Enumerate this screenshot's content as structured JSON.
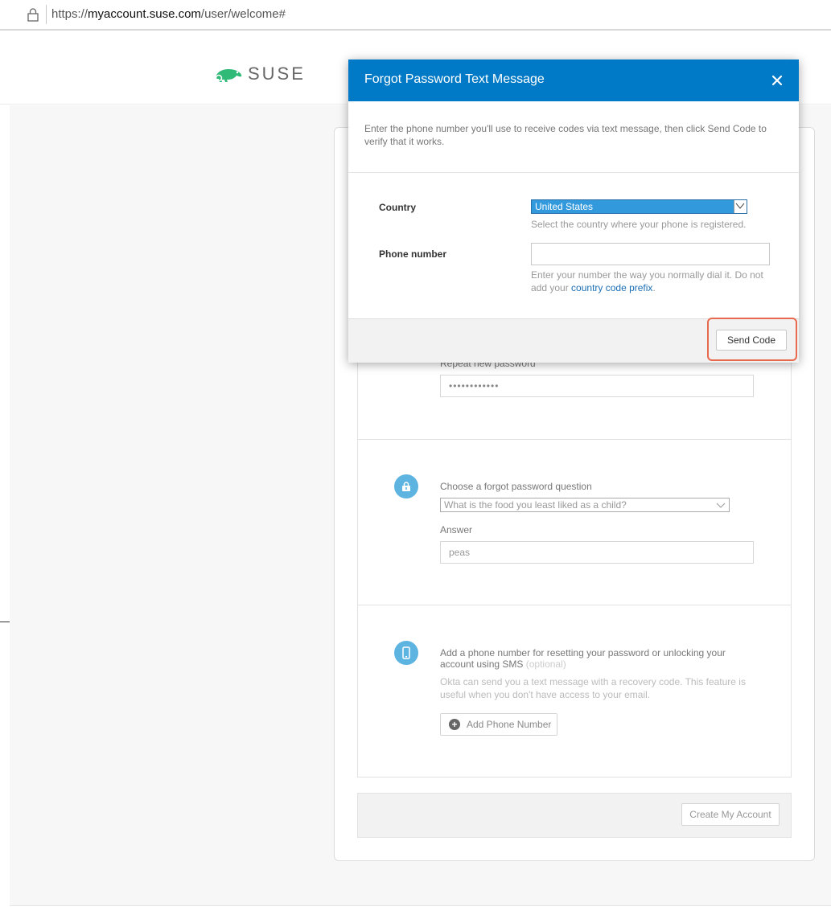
{
  "browser": {
    "url_prefix": "https://",
    "url_domain": "myaccount.suse.com",
    "url_path": "/user/welcome#"
  },
  "header": {
    "logo_text": "SUSE",
    "logo_icon": "chameleon-icon",
    "brand_color": "#30ba78"
  },
  "form": {
    "repeat_password_label": "Repeat new password",
    "repeat_password_value": "••••••••••••",
    "security_question": {
      "icon": "lock-icon",
      "label": "Choose a forgot password question",
      "selected": "What is the food you least liked as a child?",
      "answer_label": "Answer",
      "answer_value": "peas"
    },
    "sms": {
      "icon": "phone-icon",
      "title": "Add a phone number for resetting your password or unlocking your account using SMS",
      "optional": "(optional)",
      "description": "Okta can send you a text message with a recovery code. This feature is useful when you don't have access to your email.",
      "add_button": "Add Phone Number"
    },
    "create_button": "Create My Account"
  },
  "modal": {
    "title": "Forgot Password Text Message",
    "close_icon": "close-icon",
    "intro": "Enter the phone number you'll use to receive codes via text message, then click Send Code to verify that it works.",
    "country_label": "Country",
    "country_value": "United States",
    "country_hint": "Select the country where your phone is registered.",
    "phone_label": "Phone number",
    "phone_value": "",
    "phone_hint_pre": "Enter your number the way you normally dial it. Do not add your ",
    "phone_hint_link": "country code prefix",
    "phone_hint_post": ".",
    "send_button": "Send Code",
    "header_color": "#007ac6",
    "highlight_color": "#e9694e"
  }
}
